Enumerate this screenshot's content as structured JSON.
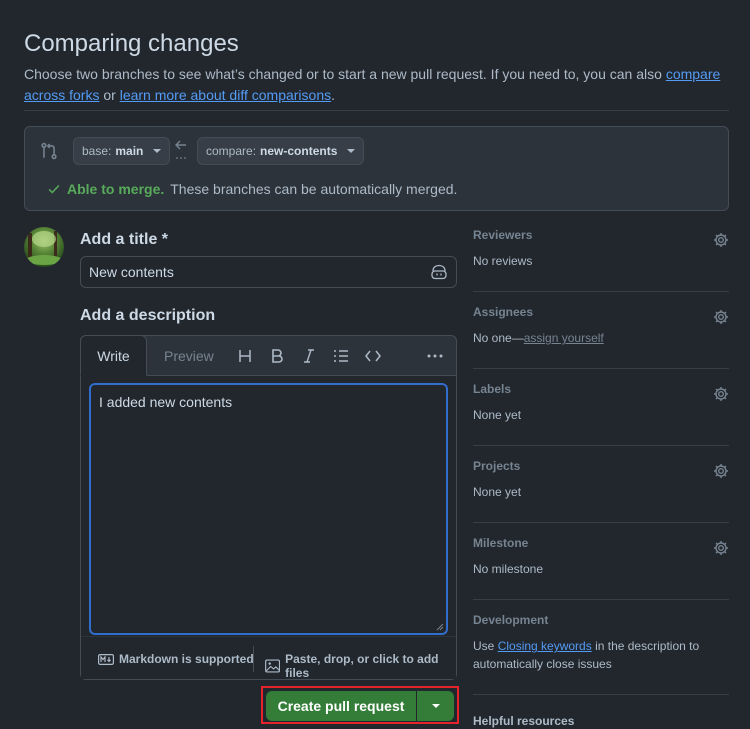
{
  "header": {
    "title": "Comparing changes",
    "subtitle_prefix": "Choose two branches to see what’s changed or to start a new pull request. If you need to, you can also ",
    "link_forks": "compare across forks",
    "or_text": " or ",
    "link_diff": "learn more about diff comparisons",
    "period": "."
  },
  "compare": {
    "base_prefix": "base:",
    "base_value": "main",
    "compare_prefix": "compare:",
    "compare_value": "new-contents",
    "merge_ok": "Able to merge.",
    "merge_text": "These branches can be automatically merged."
  },
  "form": {
    "title_label": "Add a title *",
    "title_value": "New contents",
    "description_label": "Add a description",
    "tab_write": "Write",
    "tab_preview": "Preview",
    "body_text": "I added new contents",
    "markdown_note": "Markdown is supported",
    "attach_note": "Paste, drop, or click to add files",
    "submit_label": "Create pull request"
  },
  "sidebar": {
    "reviewers": {
      "label": "Reviewers",
      "value": "No reviews"
    },
    "assignees": {
      "label": "Assignees",
      "value_prefix": "No one—",
      "value_link": "assign yourself"
    },
    "labels": {
      "label": "Labels",
      "value": "None yet"
    },
    "projects": {
      "label": "Projects",
      "value": "None yet"
    },
    "milestone": {
      "label": "Milestone",
      "value": "No milestone"
    },
    "development": {
      "label": "Development",
      "prefix": "Use ",
      "link": "Closing keywords",
      "suffix": " in the description to automatically close issues"
    },
    "helpful": {
      "label": "Helpful resources"
    }
  },
  "colors": {
    "background": "#22272e",
    "accent_link": "#539bf5",
    "success": "#57ab5a",
    "primary_button": "#347d39",
    "highlight_border": "#e5232b"
  },
  "icons": [
    "compare-icon",
    "arrow-left-icon",
    "check-icon",
    "copilot-icon",
    "heading-icon",
    "bold-icon",
    "italic-icon",
    "list-icon",
    "code-icon",
    "more-icon",
    "markdown-icon",
    "image-icon",
    "gear-icon",
    "caret-down-icon"
  ]
}
